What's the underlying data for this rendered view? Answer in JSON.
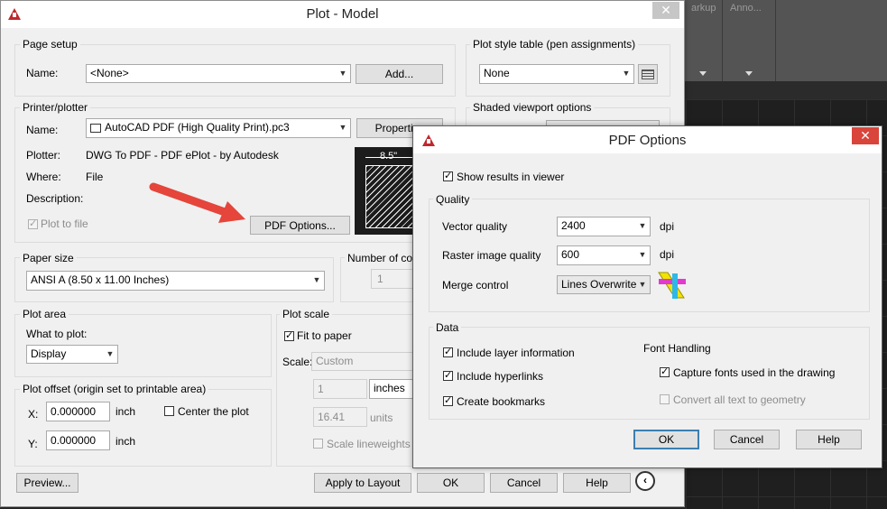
{
  "background": {
    "ribbon_tab_1": "arkup",
    "ribbon_tab_2": "Anno..."
  },
  "plot_dialog": {
    "title": "Plot - Model",
    "page_setup": {
      "group_label": "Page setup",
      "name_label": "Name:",
      "name_value": "<None>",
      "add_button": "Add..."
    },
    "plot_style_table": {
      "group_label": "Plot style table (pen assignments)",
      "value": "None"
    },
    "shaded_viewport": {
      "group_label": "Shaded viewport options"
    },
    "printer": {
      "group_label": "Printer/plotter",
      "name_label": "Name:",
      "name_value": "AutoCAD PDF (High Quality Print).pc3",
      "properties_button": "Properties",
      "plotter_label": "Plotter:",
      "plotter_value": "DWG To PDF - PDF ePlot - by Autodesk",
      "where_label": "Where:",
      "where_value": "File",
      "description_label": "Description:",
      "plot_to_file_label": "Plot to file",
      "pdf_options_button": "PDF Options...",
      "preview_dimension": "8.5\""
    },
    "paper_size": {
      "group_label": "Paper size",
      "value": "ANSI A (8.50 x 11.00 Inches)"
    },
    "copies": {
      "group_label": "Number of copi",
      "value": "1"
    },
    "plot_area": {
      "group_label": "Plot area",
      "what_label": "What to plot:",
      "what_value": "Display"
    },
    "plot_scale": {
      "group_label": "Plot scale",
      "fit_label": "Fit to paper",
      "scale_label": "Scale:",
      "scale_value": "Custom",
      "numerator": "1",
      "units_value": "inches",
      "denominator": "16.41",
      "units_label": "units",
      "lineweights_label": "Scale lineweights"
    },
    "plot_offset": {
      "group_label": "Plot offset (origin set to printable area)",
      "x_label": "X:",
      "x_value": "0.000000",
      "x_unit": "inch",
      "y_label": "Y:",
      "y_value": "0.000000",
      "y_unit": "inch",
      "center_label": "Center the plot"
    },
    "footer": {
      "preview_button": "Preview...",
      "apply_button": "Apply to Layout",
      "ok_button": "OK",
      "cancel_button": "Cancel",
      "help_button": "Help"
    }
  },
  "pdf_dialog": {
    "title": "PDF Options",
    "show_results_label": "Show results in viewer",
    "quality": {
      "group_label": "Quality",
      "vector_label": "Vector quality",
      "vector_value": "2400",
      "vector_unit": "dpi",
      "raster_label": "Raster image quality",
      "raster_value": "600",
      "raster_unit": "dpi",
      "merge_label": "Merge control",
      "merge_value": "Lines Overwrite"
    },
    "data": {
      "group_label": "Data",
      "layer_info_label": "Include layer information",
      "hyperlinks_label": "Include hyperlinks",
      "bookmarks_label": "Create bookmarks",
      "font_handling_label": "Font Handling",
      "capture_fonts_label": "Capture fonts used in the drawing",
      "convert_text_label": "Convert all text to geometry"
    },
    "footer": {
      "ok_button": "OK",
      "cancel_button": "Cancel",
      "help_button": "Help"
    }
  },
  "colors": {
    "annotation_arrow": "#e5453a",
    "logo_red": "#c0272d",
    "close_red": "#d9443b"
  }
}
